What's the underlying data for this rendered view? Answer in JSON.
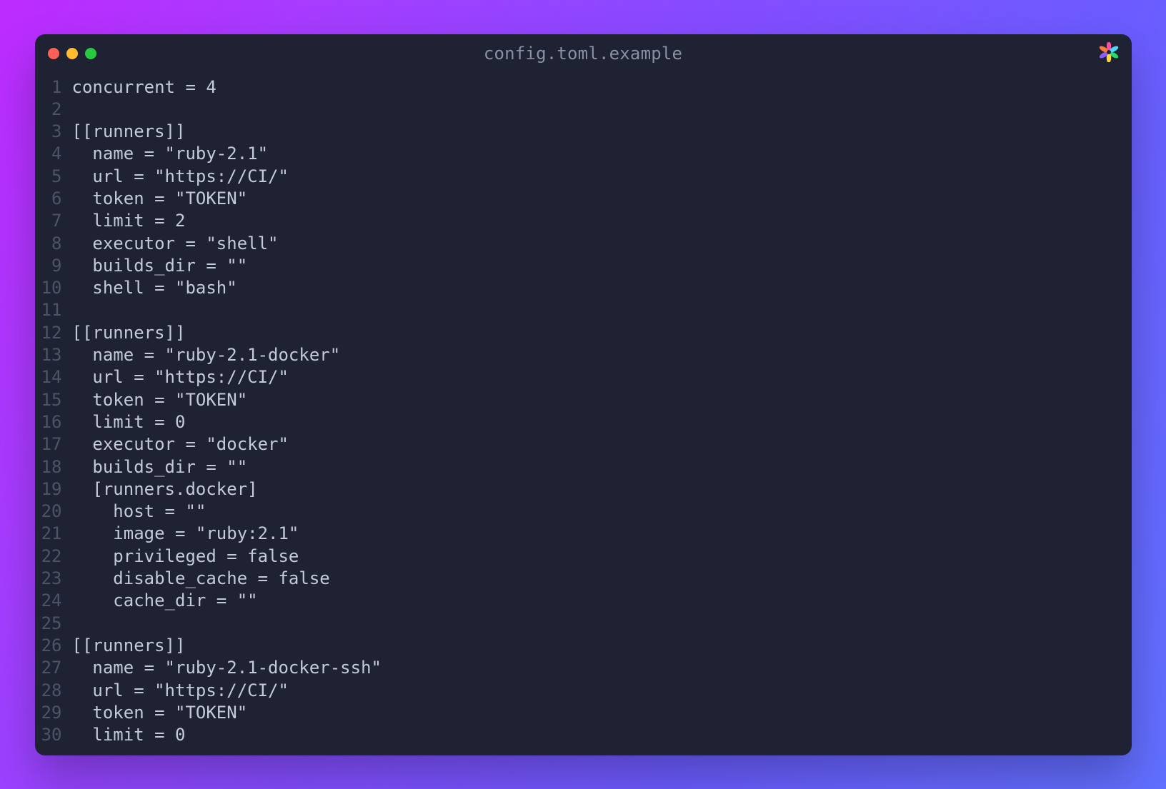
{
  "window": {
    "title": "config.toml.example",
    "traffic_lights": [
      "close",
      "minimize",
      "zoom"
    ]
  },
  "code_lines": [
    "concurrent = 4",
    "",
    "[[runners]]",
    "  name = \"ruby-2.1\"",
    "  url = \"https://CI/\"",
    "  token = \"TOKEN\"",
    "  limit = 2",
    "  executor = \"shell\"",
    "  builds_dir = \"\"",
    "  shell = \"bash\"",
    "",
    "[[runners]]",
    "  name = \"ruby-2.1-docker\"",
    "  url = \"https://CI/\"",
    "  token = \"TOKEN\"",
    "  limit = 0",
    "  executor = \"docker\"",
    "  builds_dir = \"\"",
    "  [runners.docker]",
    "    host = \"\"",
    "    image = \"ruby:2.1\"",
    "    privileged = false",
    "    disable_cache = false",
    "    cache_dir = \"\"",
    "",
    "[[runners]]",
    "  name = \"ruby-2.1-docker-ssh\"",
    "  url = \"https://CI/\"",
    "  token = \"TOKEN\"",
    "  limit = 0"
  ]
}
